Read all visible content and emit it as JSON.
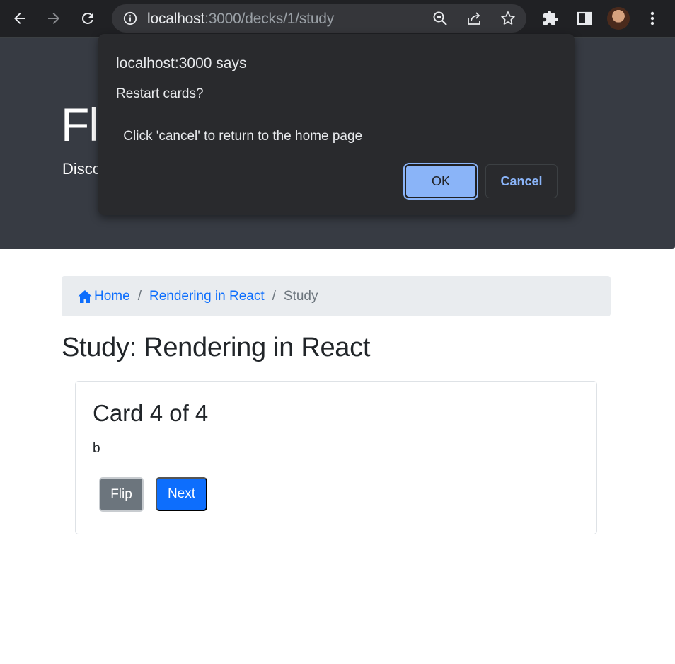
{
  "browser": {
    "url_host": "localhost",
    "url_rest": ":3000/decks/1/study"
  },
  "jumbotron": {
    "title": "Fla",
    "subtitle": "Disco"
  },
  "dialog": {
    "origin": "localhost:3000 says",
    "message_line1": "Restart cards?",
    "message_line2": " Click 'cancel' to return to the home page",
    "ok_label": "OK",
    "cancel_label": "Cancel"
  },
  "breadcrumb": {
    "home": "Home",
    "deck": "Rendering in React",
    "current": "Study",
    "separator": "/"
  },
  "page": {
    "title": "Study: Rendering in React"
  },
  "card": {
    "title": "Card 4 of 4",
    "text": "b",
    "flip_label": "Flip",
    "next_label": "Next"
  },
  "colors": {
    "link": "#0d6efd",
    "jumbotron_bg": "#373b43",
    "dialog_bg": "#292a2d",
    "ok_button": "#8ab4f8",
    "flip_button": "#6c757d",
    "next_button": "#0d6efd"
  }
}
